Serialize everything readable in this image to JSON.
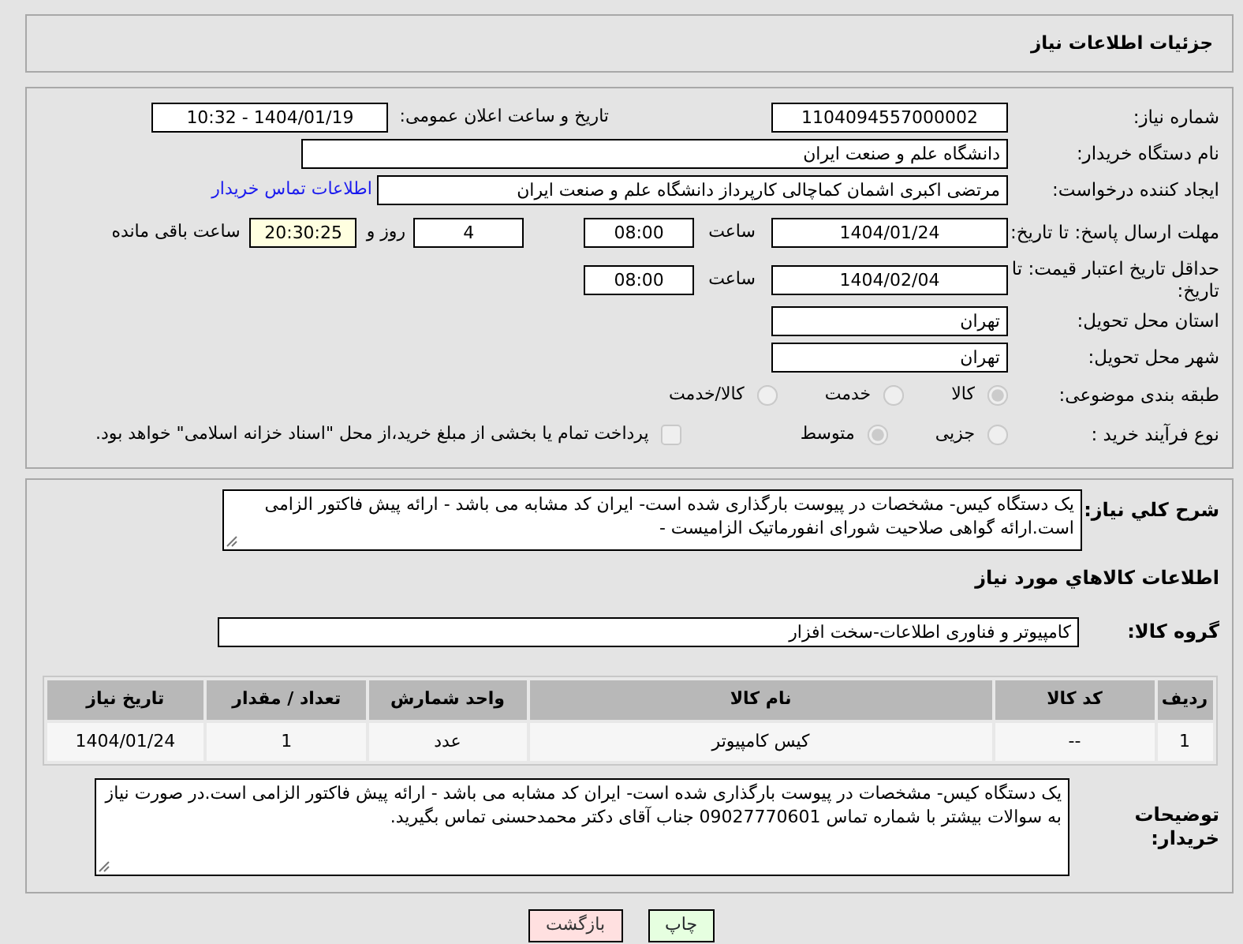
{
  "header": {
    "title": "جزئیات اطلاعات نیاز"
  },
  "need_number": {
    "label": "شماره نیاز:",
    "value": "1104094557000002"
  },
  "announce": {
    "label": "تاریخ و ساعت اعلان عمومی:",
    "value": "1404/01/19 - 10:32"
  },
  "buyer_org": {
    "label": "نام دستگاه خریدار:",
    "value": "دانشگاه علم و صنعت ایران"
  },
  "requester": {
    "label": "ایجاد کننده درخواست:",
    "value": "مرتضی اکبری اشمان کماچالی کارپرداز دانشگاه علم و صنعت ایران",
    "link": "اطلاعات تماس خریدار"
  },
  "reply_deadline": {
    "label": "مهلت ارسال پاسخ: تا تاریخ:",
    "date": "1404/01/24",
    "time_label": "ساعت",
    "time": "08:00",
    "days": "4",
    "days_label": "روز و",
    "remaining": "20:30:25",
    "remaining_label": "ساعت باقی مانده"
  },
  "price_validity": {
    "label": "حداقل تاریخ اعتبار قیمت: تا تاریخ:",
    "date": "1404/02/04",
    "time_label": "ساعت",
    "time": "08:00"
  },
  "province": {
    "label": "استان محل تحویل:",
    "value": "تهران"
  },
  "city": {
    "label": "شهر محل تحویل:",
    "value": "تهران"
  },
  "category": {
    "label": "طبقه بندی موضوعی:",
    "disabled": true,
    "options": [
      {
        "label": "کالا",
        "selected": true
      },
      {
        "label": "خدمت",
        "selected": false
      },
      {
        "label": "کالا/خدمت",
        "selected": false
      }
    ]
  },
  "purchase_process": {
    "label": "نوع فرآیند خرید :",
    "disabled": true,
    "options": [
      {
        "label": "جزیی",
        "selected": false
      },
      {
        "label": "متوسط",
        "selected": true
      }
    ],
    "payment_note": {
      "checked": false,
      "text": "پرداخت تمام یا بخشی از مبلغ خرید،از محل \"اسناد خزانه اسلامی\" خواهد بود."
    }
  },
  "description": {
    "label": "شرح کلي نیاز:",
    "value": "یک دستگاه کیس-  مشخصات در پیوست بارگذاری شده است- ایران کد مشابه می باشد - ارائه پیش فاکتور الزامی است.ارائه گواهی صلاحیت شورای انفورماتیک الزامیست -"
  },
  "goods_heading": "اطلاعات کالاهاي مورد نیاز",
  "goods_group": {
    "label": "گروه کالا:",
    "value": "کامپیوتر و فناوری اطلاعات-سخت افزار"
  },
  "table": {
    "columns": [
      "ردیف",
      "کد کالا",
      "نام کالا",
      "واحد شمارش",
      "تعداد / مقدار",
      "تاریخ نیاز"
    ],
    "rows": [
      [
        "1",
        "--",
        "کیس کامپیوتر",
        "عدد",
        "1",
        "1404/01/24"
      ]
    ]
  },
  "buyer_notes": {
    "label": "توضیحات خریدار:",
    "value": "یک دستگاه کیس-  مشخصات در پیوست بارگذاری شده است- ایران کد مشابه می باشد - ارائه پیش فاکتور الزامی است.در صورت نیاز به سوالات بیشتر با شماره تماس  09027770601 جناب آقای دکتر محمدحسنی تماس بگیرید."
  },
  "buttons": [
    {
      "label": "چاپ",
      "kind": "print"
    },
    {
      "label": "بازگشت",
      "kind": "back"
    }
  ]
}
